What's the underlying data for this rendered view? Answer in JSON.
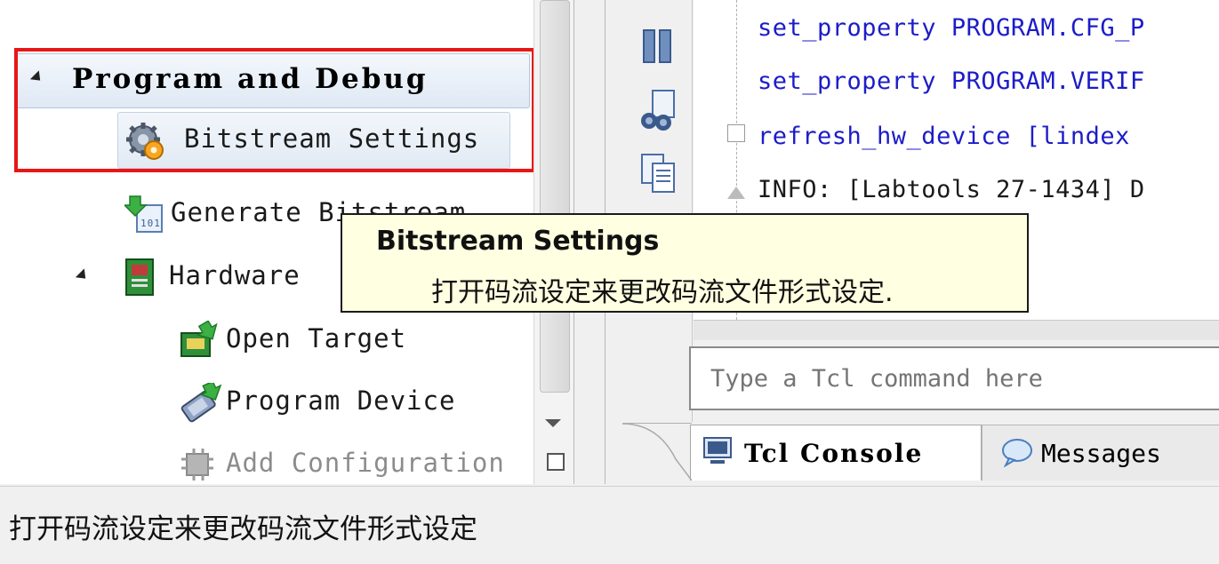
{
  "flow_navigator": {
    "section_title": "Program and Debug",
    "items": [
      {
        "label": "Bitstream Settings",
        "icon": "gear-icon"
      },
      {
        "label": "Generate Bitstream",
        "icon": "generate-bitstream-icon"
      },
      {
        "label": "Hardware",
        "icon": "hardware-board-icon"
      },
      {
        "label": "Open Target",
        "icon": "open-target-icon"
      },
      {
        "label": "Program Device",
        "icon": "program-device-icon"
      },
      {
        "label": "Add Configuration",
        "icon": "add-configuration-icon"
      }
    ]
  },
  "tcl_console": {
    "lines": [
      "set_property PROGRAM.CFG_P",
      "set_property PROGRAM.VERIF",
      "refresh_hw_device [lindex",
      "INFO: [Labtools 27-1434] D"
    ],
    "input_placeholder": "Type a Tcl command here",
    "tabs": [
      {
        "label": "Tcl Console"
      },
      {
        "label": "Messages"
      }
    ]
  },
  "tooltip": {
    "title": "Bitstream Settings",
    "description": "打开码流设定来更改码流文件形式设定."
  },
  "status_bar": {
    "text": "打开码流设定来更改码流文件形式设定"
  },
  "colors": {
    "highlight": "#e81616",
    "tcl_keyword": "#1c1cc8",
    "tooltip_bg": "#ffffe1"
  }
}
